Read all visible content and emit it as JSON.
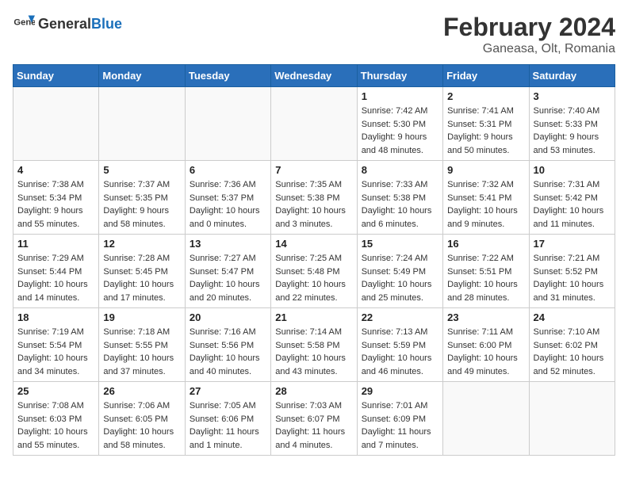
{
  "header": {
    "logo_general": "General",
    "logo_blue": "Blue",
    "title": "February 2024",
    "subtitle": "Ganeasa, Olt, Romania"
  },
  "weekdays": [
    "Sunday",
    "Monday",
    "Tuesday",
    "Wednesday",
    "Thursday",
    "Friday",
    "Saturday"
  ],
  "weeks": [
    [
      {
        "day": "",
        "info": ""
      },
      {
        "day": "",
        "info": ""
      },
      {
        "day": "",
        "info": ""
      },
      {
        "day": "",
        "info": ""
      },
      {
        "day": "1",
        "info": "Sunrise: 7:42 AM\nSunset: 5:30 PM\nDaylight: 9 hours\nand 48 minutes."
      },
      {
        "day": "2",
        "info": "Sunrise: 7:41 AM\nSunset: 5:31 PM\nDaylight: 9 hours\nand 50 minutes."
      },
      {
        "day": "3",
        "info": "Sunrise: 7:40 AM\nSunset: 5:33 PM\nDaylight: 9 hours\nand 53 minutes."
      }
    ],
    [
      {
        "day": "4",
        "info": "Sunrise: 7:38 AM\nSunset: 5:34 PM\nDaylight: 9 hours\nand 55 minutes."
      },
      {
        "day": "5",
        "info": "Sunrise: 7:37 AM\nSunset: 5:35 PM\nDaylight: 9 hours\nand 58 minutes."
      },
      {
        "day": "6",
        "info": "Sunrise: 7:36 AM\nSunset: 5:37 PM\nDaylight: 10 hours\nand 0 minutes."
      },
      {
        "day": "7",
        "info": "Sunrise: 7:35 AM\nSunset: 5:38 PM\nDaylight: 10 hours\nand 3 minutes."
      },
      {
        "day": "8",
        "info": "Sunrise: 7:33 AM\nSunset: 5:38 PM\nDaylight: 10 hours\nand 6 minutes."
      },
      {
        "day": "9",
        "info": "Sunrise: 7:32 AM\nSunset: 5:41 PM\nDaylight: 10 hours\nand 9 minutes."
      },
      {
        "day": "10",
        "info": "Sunrise: 7:31 AM\nSunset: 5:42 PM\nDaylight: 10 hours\nand 11 minutes."
      }
    ],
    [
      {
        "day": "11",
        "info": "Sunrise: 7:29 AM\nSunset: 5:44 PM\nDaylight: 10 hours\nand 14 minutes."
      },
      {
        "day": "12",
        "info": "Sunrise: 7:28 AM\nSunset: 5:45 PM\nDaylight: 10 hours\nand 17 minutes."
      },
      {
        "day": "13",
        "info": "Sunrise: 7:27 AM\nSunset: 5:47 PM\nDaylight: 10 hours\nand 20 minutes."
      },
      {
        "day": "14",
        "info": "Sunrise: 7:25 AM\nSunset: 5:48 PM\nDaylight: 10 hours\nand 22 minutes."
      },
      {
        "day": "15",
        "info": "Sunrise: 7:24 AM\nSunset: 5:49 PM\nDaylight: 10 hours\nand 25 minutes."
      },
      {
        "day": "16",
        "info": "Sunrise: 7:22 AM\nSunset: 5:51 PM\nDaylight: 10 hours\nand 28 minutes."
      },
      {
        "day": "17",
        "info": "Sunrise: 7:21 AM\nSunset: 5:52 PM\nDaylight: 10 hours\nand 31 minutes."
      }
    ],
    [
      {
        "day": "18",
        "info": "Sunrise: 7:19 AM\nSunset: 5:54 PM\nDaylight: 10 hours\nand 34 minutes."
      },
      {
        "day": "19",
        "info": "Sunrise: 7:18 AM\nSunset: 5:55 PM\nDaylight: 10 hours\nand 37 minutes."
      },
      {
        "day": "20",
        "info": "Sunrise: 7:16 AM\nSunset: 5:56 PM\nDaylight: 10 hours\nand 40 minutes."
      },
      {
        "day": "21",
        "info": "Sunrise: 7:14 AM\nSunset: 5:58 PM\nDaylight: 10 hours\nand 43 minutes."
      },
      {
        "day": "22",
        "info": "Sunrise: 7:13 AM\nSunset: 5:59 PM\nDaylight: 10 hours\nand 46 minutes."
      },
      {
        "day": "23",
        "info": "Sunrise: 7:11 AM\nSunset: 6:00 PM\nDaylight: 10 hours\nand 49 minutes."
      },
      {
        "day": "24",
        "info": "Sunrise: 7:10 AM\nSunset: 6:02 PM\nDaylight: 10 hours\nand 52 minutes."
      }
    ],
    [
      {
        "day": "25",
        "info": "Sunrise: 7:08 AM\nSunset: 6:03 PM\nDaylight: 10 hours\nand 55 minutes."
      },
      {
        "day": "26",
        "info": "Sunrise: 7:06 AM\nSunset: 6:05 PM\nDaylight: 10 hours\nand 58 minutes."
      },
      {
        "day": "27",
        "info": "Sunrise: 7:05 AM\nSunset: 6:06 PM\nDaylight: 11 hours\nand 1 minute."
      },
      {
        "day": "28",
        "info": "Sunrise: 7:03 AM\nSunset: 6:07 PM\nDaylight: 11 hours\nand 4 minutes."
      },
      {
        "day": "29",
        "info": "Sunrise: 7:01 AM\nSunset: 6:09 PM\nDaylight: 11 hours\nand 7 minutes."
      },
      {
        "day": "",
        "info": ""
      },
      {
        "day": "",
        "info": ""
      }
    ]
  ]
}
